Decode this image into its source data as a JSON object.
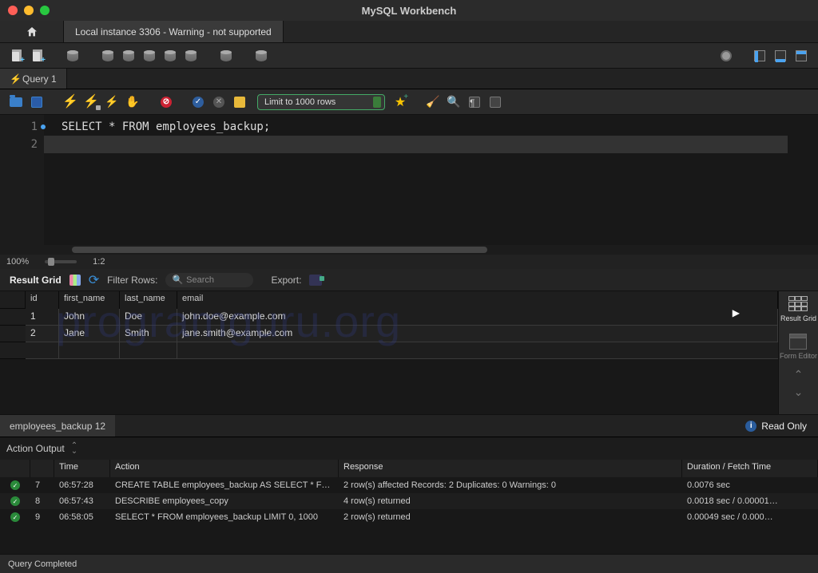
{
  "window": {
    "title": "MySQL Workbench"
  },
  "connection_tab": "Local instance 3306 - Warning - not supported",
  "query_tab": "Query 1",
  "editor": {
    "line1": "SELECT * FROM employees_backup;",
    "line_numbers": [
      "1",
      "2"
    ]
  },
  "limit_selector": "Limit to 1000 rows",
  "zoom": {
    "percent": "100%",
    "ratio": "1:2"
  },
  "result_toolbar": {
    "title": "Result Grid",
    "filter_label": "Filter Rows:",
    "search_placeholder": "Search",
    "export_label": "Export:"
  },
  "result_table": {
    "columns": [
      "id",
      "first_name",
      "last_name",
      "email"
    ],
    "rows": [
      {
        "id": "1",
        "first_name": "John",
        "last_name": "Doe",
        "email": "john.doe@example.com"
      },
      {
        "id": "2",
        "first_name": "Jane",
        "last_name": "Smith",
        "email": "jane.smith@example.com"
      }
    ]
  },
  "side_panel": {
    "result_grid": "Result Grid",
    "form_editor": "Form Editor"
  },
  "result_tab": "employees_backup 12",
  "read_only": "Read Only",
  "output": {
    "title": "Action Output",
    "columns": {
      "time": "Time",
      "action": "Action",
      "response": "Response",
      "duration": "Duration / Fetch Time"
    },
    "rows": [
      {
        "n": "7",
        "time": "06:57:28",
        "action": "CREATE TABLE employees_backup AS SELECT * FR…",
        "response": "2 row(s) affected Records: 2  Duplicates: 0  Warnings: 0",
        "duration": "0.0076 sec"
      },
      {
        "n": "8",
        "time": "06:57:43",
        "action": "DESCRIBE employees_copy",
        "response": "4 row(s) returned",
        "duration": "0.0018 sec / 0.00001…"
      },
      {
        "n": "9",
        "time": "06:58:05",
        "action": "SELECT * FROM employees_backup LIMIT 0, 1000",
        "response": "2 row(s) returned",
        "duration": "0.00049 sec / 0.000…"
      }
    ]
  },
  "status": "Query Completed",
  "watermark": "programguru.org"
}
